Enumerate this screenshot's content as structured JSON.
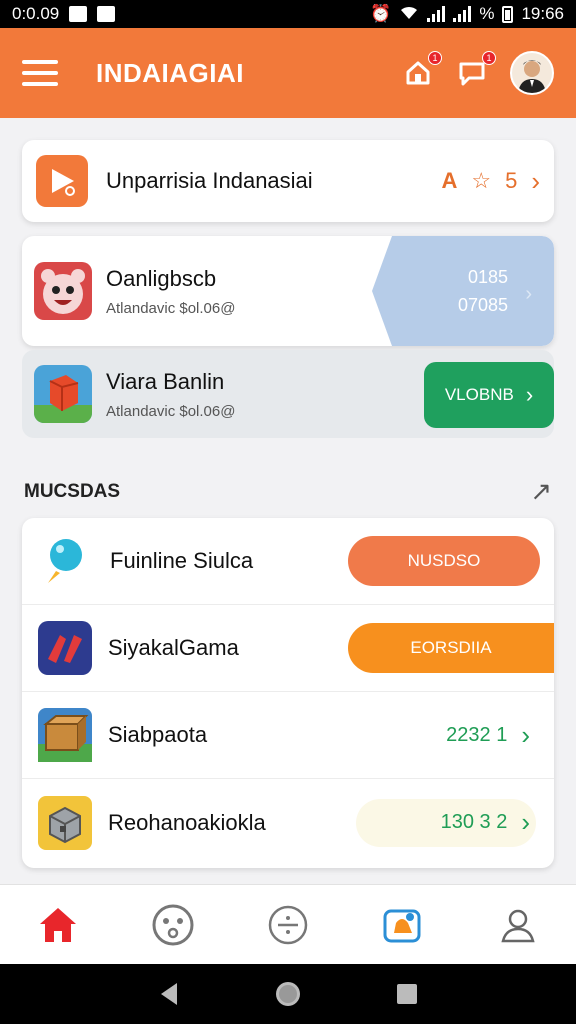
{
  "status_bar": {
    "time": "0:0.09",
    "right_text": "%",
    "clock": "19:66"
  },
  "header": {
    "title": "INDAIAGIAI",
    "badge_home": "1",
    "badge_chat": "1"
  },
  "featured": {
    "title": "Unparrisia Indanasiai",
    "rating_letter": "A",
    "rating_value": "5"
  },
  "promo1": {
    "title": "Oanligbscb",
    "subtitle": "Atlandavic $ol.06@",
    "flag_line1": "0185",
    "flag_line2": "07085"
  },
  "promo2": {
    "title": "Viara Banlin",
    "subtitle": "Atlandavic $ol.06@",
    "button_label": "VLOBNB"
  },
  "section": {
    "title": "MUCSDAS"
  },
  "list": [
    {
      "label": "Fuinline Siulca",
      "action": "NUSDSO",
      "icon": "balloon-icon"
    },
    {
      "label": "SiyakalGama",
      "action": "EORSDIIA",
      "icon": "game-icon"
    },
    {
      "label": "Siabpaota",
      "score": "2232 1",
      "icon": "crate-icon"
    },
    {
      "label": "Reohanoakiokla",
      "score": "130 3 2",
      "icon": "block-icon"
    }
  ],
  "colors": {
    "brand": "#f2793a",
    "green": "#1fa05e",
    "blue_flag": "#b6cce8",
    "nav_active": "#e8262b"
  }
}
